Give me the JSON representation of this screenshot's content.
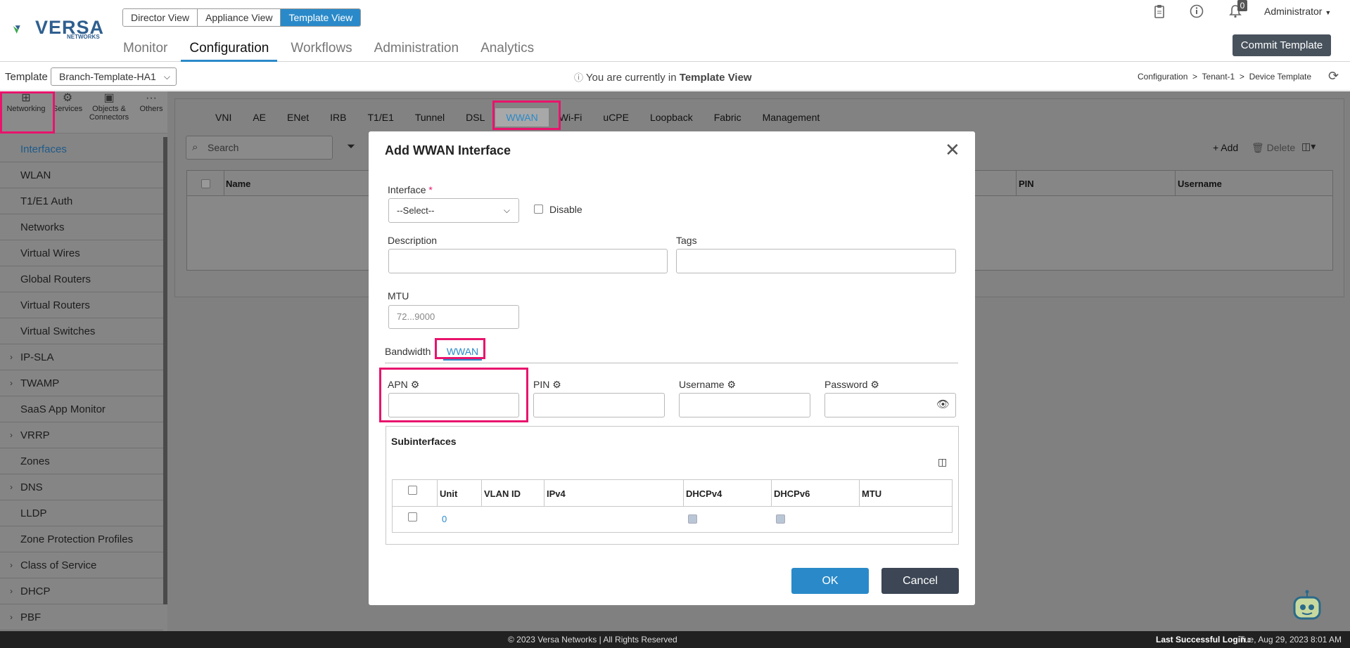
{
  "header": {
    "logo_text": "VERSA",
    "logo_sub": "NETWORKS",
    "view_switch": [
      "Director View",
      "Appliance View",
      "Template View"
    ],
    "main_nav": [
      "Monitor",
      "Configuration",
      "Workflows",
      "Administration",
      "Analytics"
    ],
    "notification_count": "0",
    "user": "Administrator",
    "commit_button": "Commit Template"
  },
  "subbar": {
    "template_label": "Template",
    "template_value": "Branch-Template-HA1",
    "info_prefix": "You are currently in",
    "info_bold": "Template View",
    "breadcrumb": [
      "Configuration",
      "Tenant-1",
      "Device Template"
    ]
  },
  "left_icons": [
    "Networking",
    "Services",
    "Objects &",
    "Connectors",
    "Others"
  ],
  "sidebar": [
    "Interfaces",
    "WLAN",
    "T1/E1 Auth",
    "Networks",
    "Virtual Wires",
    "Global Routers",
    "Virtual Routers",
    "Virtual Switches",
    "IP-SLA",
    "TWAMP",
    "SaaS App Monitor",
    "VRRP",
    "Zones",
    "DNS",
    "LLDP",
    "Zone Protection Profiles",
    "Class of Service",
    "DHCP",
    "PBF"
  ],
  "tabs": [
    "VNI",
    "AE",
    "ENet",
    "IRB",
    "T1/E1",
    "Tunnel",
    "DSL",
    "WWAN",
    "Wi-Fi",
    "uCPE",
    "Loopback",
    "Fabric",
    "Management"
  ],
  "table": {
    "search_placeholder": "Search",
    "add_label": "Add",
    "delete_label": "Delete",
    "columns": [
      "Name",
      "PIN",
      "Username"
    ]
  },
  "modal": {
    "title": "Add WWAN Interface",
    "interface_label": "Interface",
    "interface_required": "*",
    "interface_value": "--Select--",
    "disable_label": "Disable",
    "description_label": "Description",
    "tags_label": "Tags",
    "mtu_label": "MTU",
    "mtu_placeholder": "72...9000",
    "subtabs": [
      "Bandwidth",
      "WWAN"
    ],
    "apn_label": "APN",
    "pin_label": "PIN",
    "username_label": "Username",
    "password_label": "Password",
    "subinterfaces_title": "Subinterfaces",
    "sub_columns": [
      "Unit",
      "VLAN ID",
      "IPv4",
      "DHCPv4",
      "DHCPv6",
      "MTU"
    ],
    "sub_row_unit": "0",
    "ok_label": "OK",
    "cancel_label": "Cancel"
  },
  "footer": {
    "copyright": "© 2023 Versa Networks | All Rights Reserved",
    "last_login_label": "Last Successful Login :",
    "last_login_value": "Tue, Aug 29, 2023 8:01 AM"
  },
  "colors": {
    "accent": "#2a8ac9",
    "highlight": "#e8146c",
    "dark_button": "#3c4654"
  }
}
